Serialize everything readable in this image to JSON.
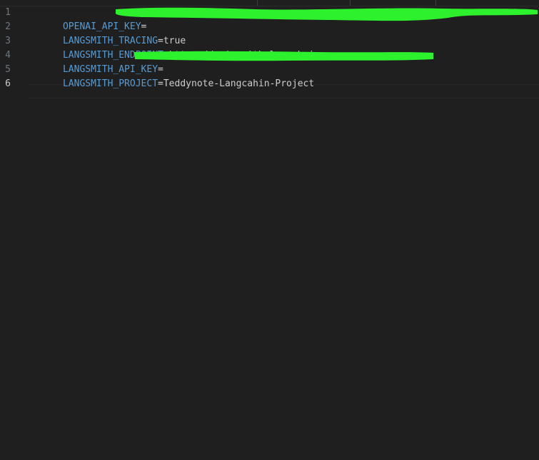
{
  "editor": {
    "colors": {
      "background": "#1f1f1f",
      "key": "#569cd6",
      "text": "#cccccc",
      "line_number": "#6e7681",
      "redaction": "#2ef12e"
    },
    "active_line": "6",
    "lines": [
      {
        "number": "1",
        "key": "OPENAI_API_KEY",
        "eq": "=",
        "value": "",
        "redacted": true
      },
      {
        "number": "2",
        "key": "LANGSMITH_TRACING",
        "eq": "=",
        "value": "true"
      },
      {
        "number": "3",
        "key": "LANGSMITH_ENDPOINT",
        "eq": "=",
        "value": "https://api.smith.langchain.com"
      },
      {
        "number": "4",
        "key": "LANGSMITH_API_KEY",
        "eq": "=",
        "value": "",
        "redacted": true
      },
      {
        "number": "5",
        "key": "LANGSMITH_PROJECT",
        "eq": "=",
        "value": "Teddynote-Langcahin-Project"
      },
      {
        "number": "6",
        "key": "",
        "eq": "",
        "value": ""
      }
    ]
  }
}
